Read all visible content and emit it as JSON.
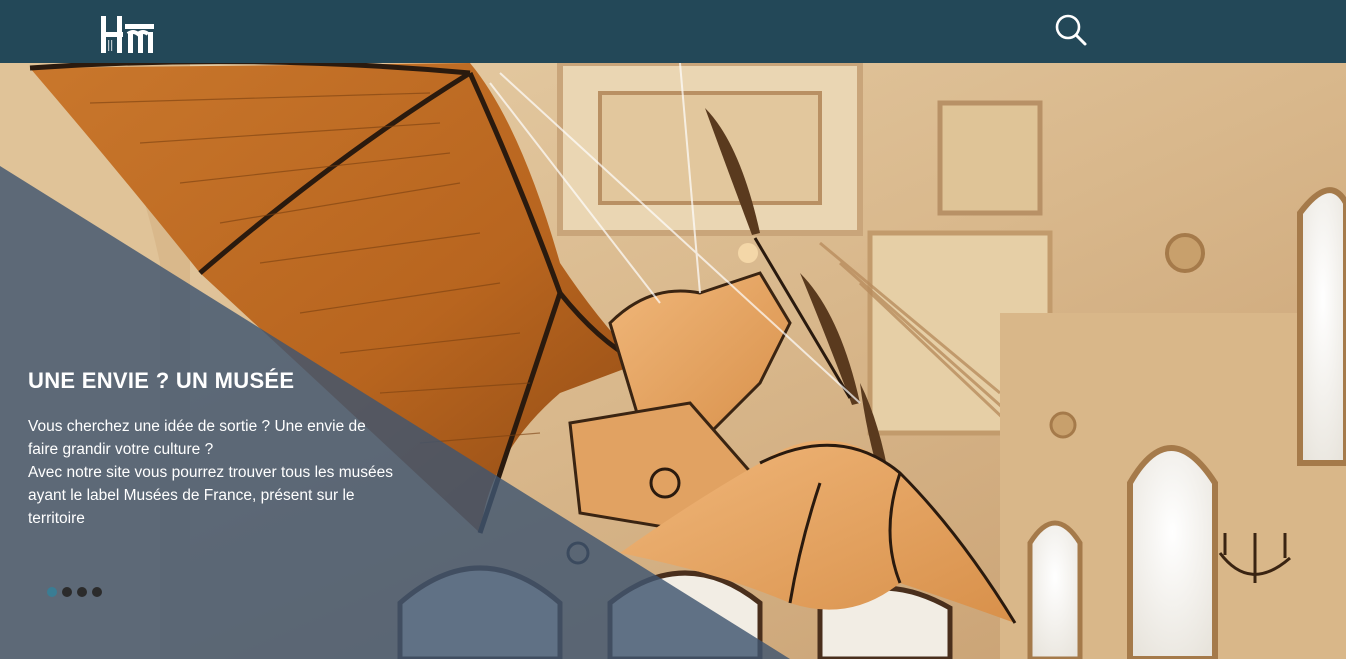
{
  "header": {
    "logo_alt": "Musées de France logo",
    "search_icon": "search-icon",
    "background_color": "#234858"
  },
  "hero": {
    "title": "UNE ENVIE ? UN MUSÉE",
    "lines": [
      "Vous cherchez une idée de sortie ? Une envie de faire grandir votre culture ?",
      "Avec notre site vous pourrez trouver tous les musées ayant le label Musées de France, présent sur le territoire"
    ],
    "overlay_color": "#3f5670",
    "carousel": {
      "count": 4,
      "active_index": 0,
      "active_color": "#3a7d94",
      "inactive_color": "#2b2b2b"
    }
  }
}
